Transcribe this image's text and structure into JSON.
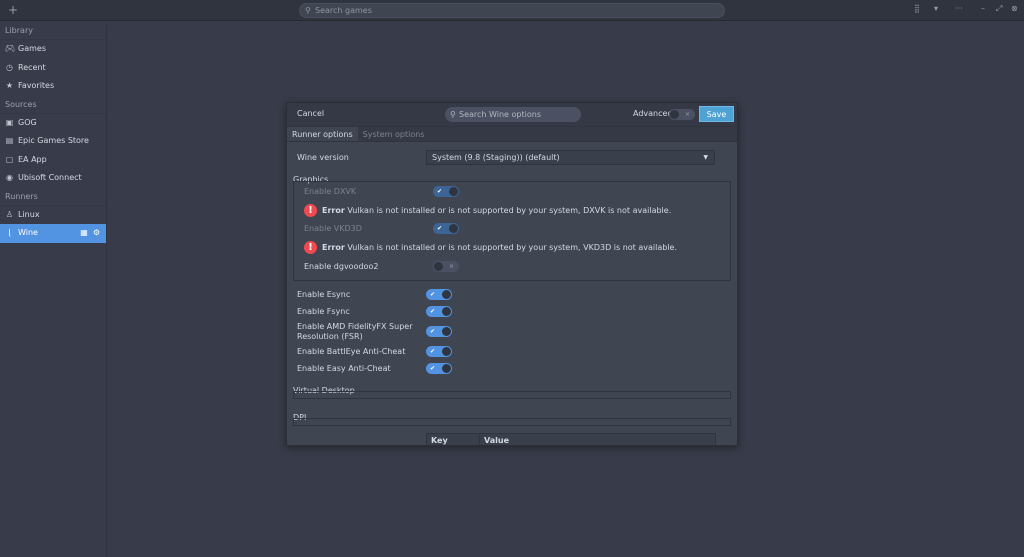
{
  "topbar": {
    "add_icon": "plus-icon",
    "search_placeholder": "Search games",
    "right_icons": [
      "grid-view-icon",
      "dropdown-icon",
      "more-icon",
      "minimize-icon",
      "maximize-icon",
      "close-icon"
    ]
  },
  "sidebar": {
    "sections": [
      {
        "title": "Library",
        "items": [
          {
            "label": "Games",
            "icon": "gamepad-icon"
          },
          {
            "label": "Recent",
            "icon": "clock-icon"
          },
          {
            "label": "Favorites",
            "icon": "star-icon"
          }
        ]
      },
      {
        "title": "Sources",
        "items": [
          {
            "label": "GOG",
            "icon": "gog-icon"
          },
          {
            "label": "Epic Games Store",
            "icon": "epic-icon"
          },
          {
            "label": "EA App",
            "icon": "ea-icon"
          },
          {
            "label": "Ubisoft Connect",
            "icon": "ubisoft-icon"
          }
        ]
      },
      {
        "title": "Runners",
        "items": [
          {
            "label": "Linux",
            "icon": "linux-icon"
          },
          {
            "label": "Wine",
            "icon": "wine-icon",
            "active": true
          }
        ]
      }
    ]
  },
  "dialog": {
    "cancel": "Cancel",
    "search_placeholder": "Search Wine options",
    "advanced": "Advanced",
    "advanced_on": false,
    "save": "Save",
    "tabs": [
      "Runner options",
      "System options"
    ],
    "wine_version_label": "Wine version",
    "wine_version_value": "System (9.8 (Staging)) (default)",
    "graphics": "Graphics",
    "dxvk": "Enable DXVK",
    "dxvk_on": true,
    "error_word": "Error",
    "dxvk_error": "Vulkan is not installed or is not supported by your system, DXVK is not available.",
    "vkd3d": "Enable VKD3D",
    "vkd3d_on": true,
    "vkd3d_error": "Vulkan is not installed or is not supported by your system, VKD3D is not available.",
    "dgvoodoo2": "Enable dgvoodoo2",
    "dgvoodoo2_on": false,
    "esync": "Enable Esync",
    "fsync": "Enable Fsync",
    "fsr_line1": "Enable AMD FidelityFX Super",
    "fsr_line2": "Resolution (FSR)",
    "battleye": "Enable BattlEye Anti-Cheat",
    "eac": "Enable Easy Anti-Cheat",
    "virtual_desktop": "Virtual Desktop",
    "dpi": "DPI",
    "table_headers": [
      "Key",
      "Value"
    ]
  },
  "colors": {
    "accent": "#5294e2",
    "save": "#4fa3d4",
    "error": "#f04a50"
  }
}
